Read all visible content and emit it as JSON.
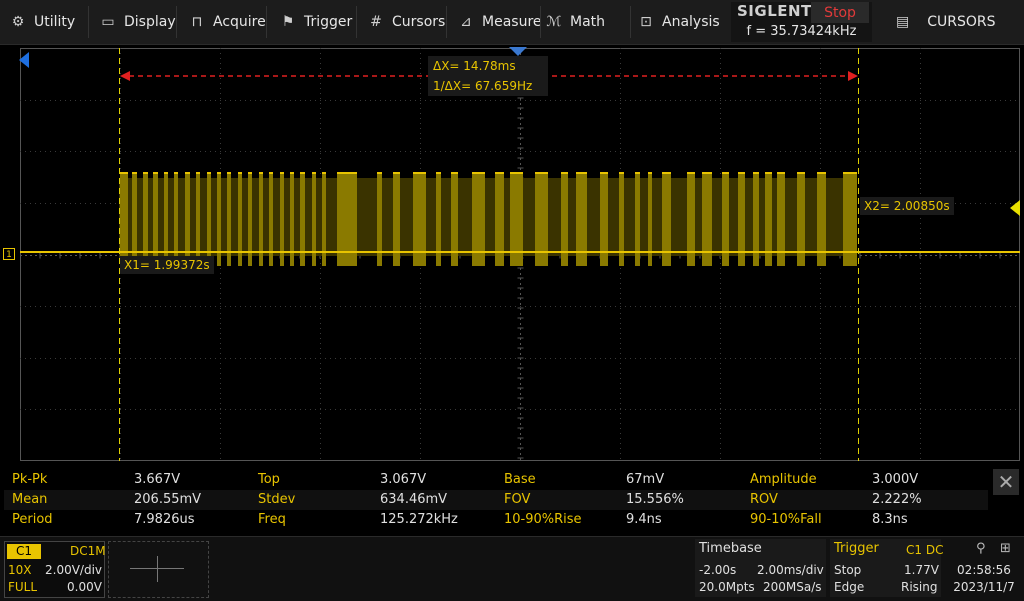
{
  "menu": {
    "utility": "Utility",
    "display": "Display",
    "acquire": "Acquire",
    "trigger": "Trigger",
    "cursors": "Cursors",
    "measure": "Measure",
    "math": "Math",
    "analysis": "Analysis"
  },
  "brand": {
    "name": "SIGLENT",
    "status": "Stop",
    "freq": "f = 35.73424kHz"
  },
  "right_tab": {
    "label": "CURSORS"
  },
  "cursors": {
    "x1": "X1= 1.99372s",
    "x2": "X2= 2.00850s",
    "delta_x": "ΔX= 14.78ms",
    "inv_delta_x": "1/ΔX= 67.659Hz"
  },
  "channel_marker": "1",
  "measurements": [
    [
      {
        "label": "Pk-Pk",
        "value": "3.667V"
      },
      {
        "label": "Top",
        "value": "3.067V"
      },
      {
        "label": "Base",
        "value": "67mV"
      },
      {
        "label": "Amplitude",
        "value": "3.000V"
      }
    ],
    [
      {
        "label": "Mean",
        "value": "206.55mV"
      },
      {
        "label": "Stdev",
        "value": "634.46mV"
      },
      {
        "label": "FOV",
        "value": "15.556%"
      },
      {
        "label": "ROV",
        "value": "2.222%"
      }
    ],
    [
      {
        "label": "Period",
        "value": "7.9826us"
      },
      {
        "label": "Freq",
        "value": "125.272kHz"
      },
      {
        "label": "10-90%Rise",
        "value": "9.4ns"
      },
      {
        "label": "90-10%Fall",
        "value": "8.3ns"
      }
    ]
  ],
  "channel": {
    "name": "C1",
    "coupling": "DC1M",
    "probe": "10X",
    "scale": "2.00V/div",
    "bandwidth": "FULL",
    "offset": "0.00V"
  },
  "timebase": {
    "title": "Timebase",
    "delay": "-2.00s",
    "scale": "2.00ms/div",
    "memory": "20.0Mpts",
    "sample_rate": "200MSa/s"
  },
  "trigger": {
    "title": "Trigger",
    "source": "C1 DC",
    "state": "Stop",
    "level": "1.77V",
    "type": "Edge",
    "slope": "Rising"
  },
  "system": {
    "time": "02:58:56",
    "date": "2023/11/7"
  },
  "colors": {
    "channel1": "#e8c400",
    "cursor_dash": "#e0d000",
    "delta_arrow": "#e02020",
    "status_stop": "#e23a3a"
  }
}
